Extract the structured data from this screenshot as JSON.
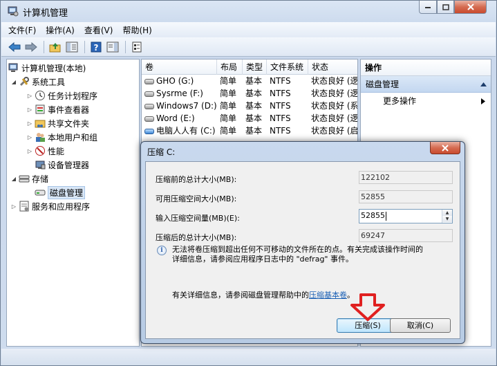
{
  "window": {
    "title": "计算机管理"
  },
  "menu": [
    "文件(F)",
    "操作(A)",
    "查看(V)",
    "帮助(H)"
  ],
  "tree": {
    "root": "计算机管理(本地)",
    "system_tools": "系统工具",
    "task_scheduler": "任务计划程序",
    "event_viewer": "事件查看器",
    "shared_folders": "共享文件夹",
    "local_users": "本地用户和组",
    "performance": "性能",
    "device_manager": "设备管理器",
    "storage": "存储",
    "disk_management": "磁盘管理",
    "services": "服务和应用程序"
  },
  "list": {
    "columns": [
      "卷",
      "布局",
      "类型",
      "文件系统",
      "状态"
    ],
    "rows": [
      {
        "volume": "GHO (G:)",
        "layout": "简单",
        "type": "基本",
        "fs": "NTFS",
        "status": "状态良好 (逻"
      },
      {
        "volume": "Sysrme (F:)",
        "layout": "简单",
        "type": "基本",
        "fs": "NTFS",
        "status": "状态良好 (逻"
      },
      {
        "volume": "Windows7 (D:)",
        "layout": "简单",
        "type": "基本",
        "fs": "NTFS",
        "status": "状态良好 (系"
      },
      {
        "volume": "Word (E:)",
        "layout": "简单",
        "type": "基本",
        "fs": "NTFS",
        "status": "状态良好 (逻"
      },
      {
        "volume": "电脑人人有 (C:)",
        "layout": "简单",
        "type": "基本",
        "fs": "NTFS",
        "status": "状态良好 (启"
      }
    ]
  },
  "actions": {
    "header": "操作",
    "section": "磁盘管理",
    "more": "更多操作"
  },
  "dialog": {
    "title": "压缩 C:",
    "total_before_label": "压缩前的总计大小(MB):",
    "total_before_value": "122102",
    "available_label": "可用压缩空间大小(MB):",
    "available_value": "52855",
    "input_label": "输入压缩空间量(MB)(E):",
    "input_value": "52855",
    "total_after_label": "压缩后的总计大小(MB):",
    "total_after_value": "69247",
    "info_line1": "无法将卷压缩到超出任何不可移动的文件所在的点。有关完成该操作时间的",
    "info_line2": "详细信息，请参阅应用程序日志中的 \"defrag\" 事件。",
    "help_prefix": "有关详细信息，请参阅磁盘管理帮助中的",
    "help_link": "压缩基本卷",
    "help_suffix": "。",
    "ok_label": "压缩(S)",
    "cancel_label": "取消(C)"
  }
}
